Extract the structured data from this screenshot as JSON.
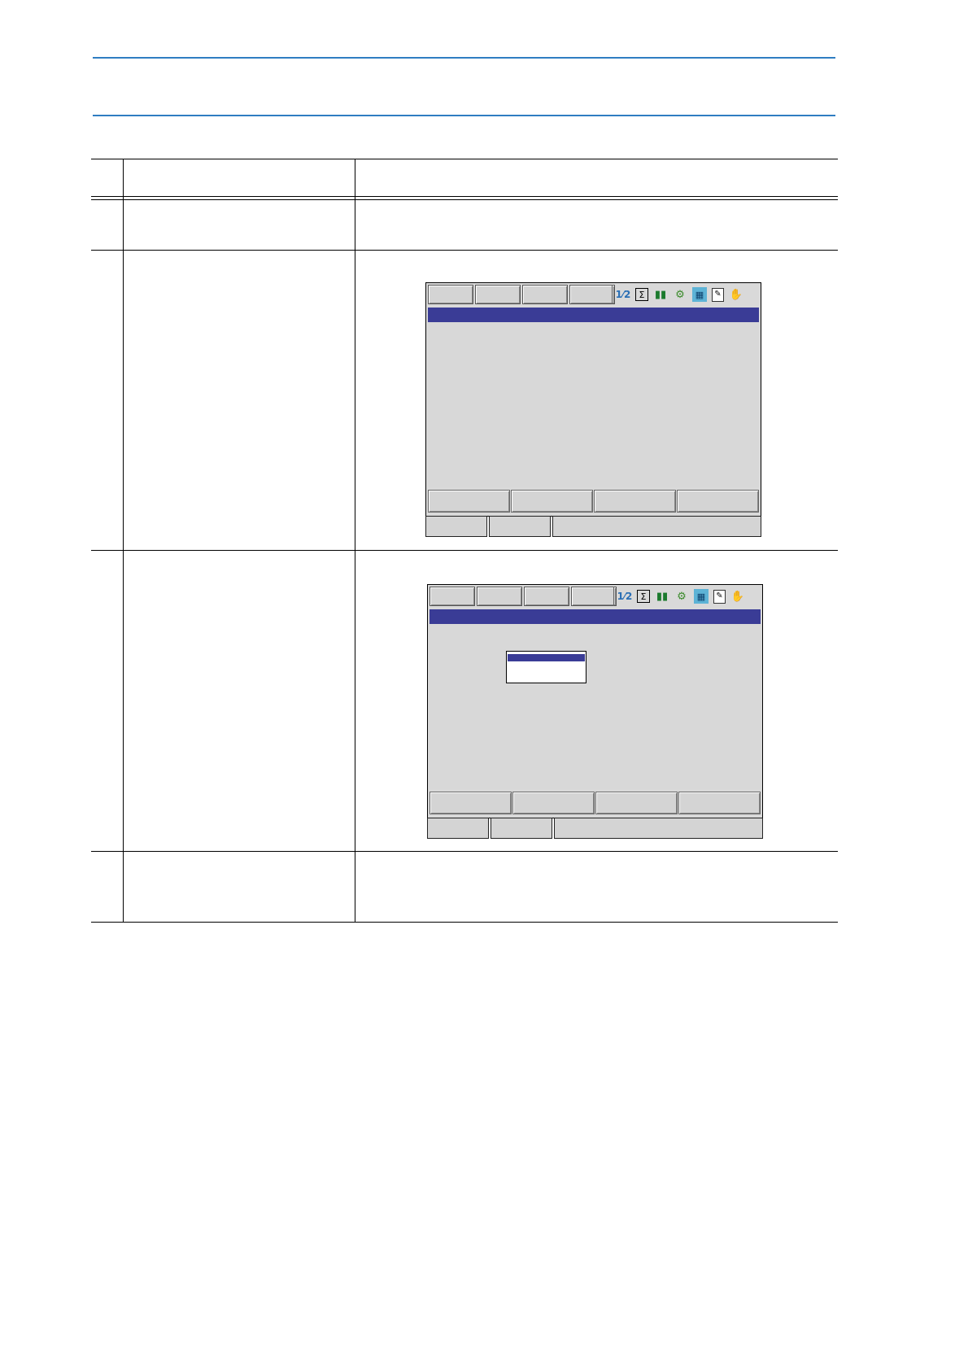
{
  "page": {
    "accent_color": "#2f7dc2"
  },
  "table": {
    "rows": [
      "header",
      "row-1",
      "row-2",
      "row-3",
      "row-4"
    ]
  },
  "screen": {
    "tabs": [
      "",
      "",
      "",
      ""
    ],
    "status_icons": [
      "numbers-icon",
      "sigma-icon",
      "signal-bars-icon",
      "robot-icon",
      "grid-icon",
      "document-edit-icon",
      "hand-icon"
    ],
    "title_color": "#3a3c96",
    "function_keys": [
      "",
      "",
      "",
      ""
    ],
    "status_boxes": [
      "",
      "",
      ""
    ]
  }
}
